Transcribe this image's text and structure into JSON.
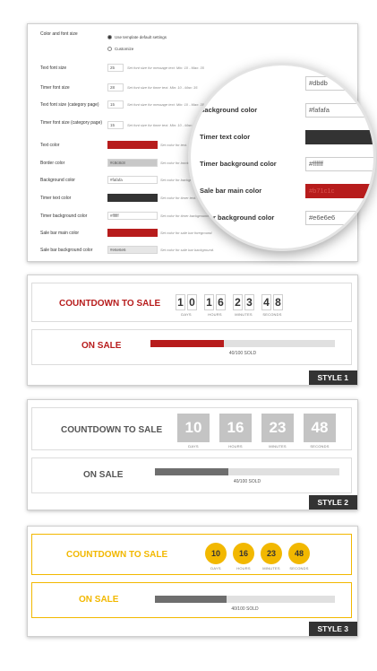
{
  "settings": {
    "rows": [
      {
        "label": "Color and font size",
        "type": "radio"
      },
      {
        "label": "Text font size",
        "value": "25",
        "hint": "Set font size for message text. Min: 10 - Max: 35"
      },
      {
        "label": "Timer font size",
        "value": "28",
        "hint": "Set font size for timer text. Min: 10 - Max: 35"
      },
      {
        "label": "Text font size (category page)",
        "value": "15",
        "hint": "Set font size for message text. Min: 10 - Max: 35"
      },
      {
        "label": "Timer font size (category page)",
        "value": "15",
        "hint": "Set font size for timer text. Min: 10 - Max: 35"
      },
      {
        "label": "Text color",
        "value": "",
        "swatch": "#b71c1c",
        "hint": "Set color for text."
      },
      {
        "label": "Border color",
        "value": "#c8c8c8",
        "hint": "Set color for border."
      },
      {
        "label": "Background color",
        "value": "#fafafa",
        "hint": "Set color for background."
      },
      {
        "label": "Timer text color",
        "value": "",
        "swatch": "#333333",
        "hint": "Set color for timer text."
      },
      {
        "label": "Timer background color",
        "value": "#ffffff",
        "hint": "Set color for timer background."
      },
      {
        "label": "Sale bar main color",
        "value": "",
        "swatch": "#b71c1c",
        "hint": "Set color for sale bar foreground."
      },
      {
        "label": "Sale bar background color",
        "value": "#e6e6e6",
        "hint": "Set color for sale bar background."
      }
    ],
    "radio_options": [
      "Use template default settings",
      "Customize"
    ]
  },
  "magnifier": {
    "rows": [
      {
        "label": "color",
        "value": "#dbdb"
      },
      {
        "label": "Background color",
        "value": "#fafafa"
      },
      {
        "label": "Timer text color",
        "value": "",
        "swatch": "#333333"
      },
      {
        "label": "Timer background color",
        "value": "#ffffff"
      },
      {
        "label": "Sale bar main color",
        "value": "#b71c1c",
        "swatch": "#b71c1c"
      },
      {
        "label": "e bar background color",
        "value": "#e6e6e6"
      }
    ]
  },
  "styles": [
    {
      "name": "STYLE 1",
      "countdown_title": "COUNTDOWN TO SALE",
      "sale_title": "ON SALE",
      "sold_text": "40/100 SOLD",
      "progress": 0.4,
      "title_color": "#b71c1c",
      "fill_color": "#b71c1c",
      "units": [
        {
          "value": "10",
          "label": "DAYS"
        },
        {
          "value": "16",
          "label": "HOURS"
        },
        {
          "value": "23",
          "label": "MINUTES"
        },
        {
          "value": "48",
          "label": "SECONDS"
        }
      ]
    },
    {
      "name": "STYLE 2",
      "countdown_title": "COUNTDOWN TO SALE",
      "sale_title": "ON SALE",
      "sold_text": "40/100 SOLD",
      "progress": 0.4,
      "title_color": "#555555",
      "fill_color": "#6e6e6e",
      "units": [
        {
          "value": "10",
          "label": "DAYS"
        },
        {
          "value": "16",
          "label": "HOURS"
        },
        {
          "value": "23",
          "label": "MINUTES"
        },
        {
          "value": "48",
          "label": "SECONDS"
        }
      ]
    },
    {
      "name": "STYLE 3",
      "countdown_title": "COUNTDOWN TO SALE",
      "sale_title": "ON SALE",
      "sold_text": "40/100 SOLD",
      "progress": 0.4,
      "title_color": "#f2b800",
      "fill_color": "#6e6e6e",
      "units": [
        {
          "value": "10",
          "label": "DAYS"
        },
        {
          "value": "16",
          "label": "HOURS"
        },
        {
          "value": "23",
          "label": "MINUTES"
        },
        {
          "value": "48",
          "label": "SECONDS"
        }
      ]
    }
  ]
}
